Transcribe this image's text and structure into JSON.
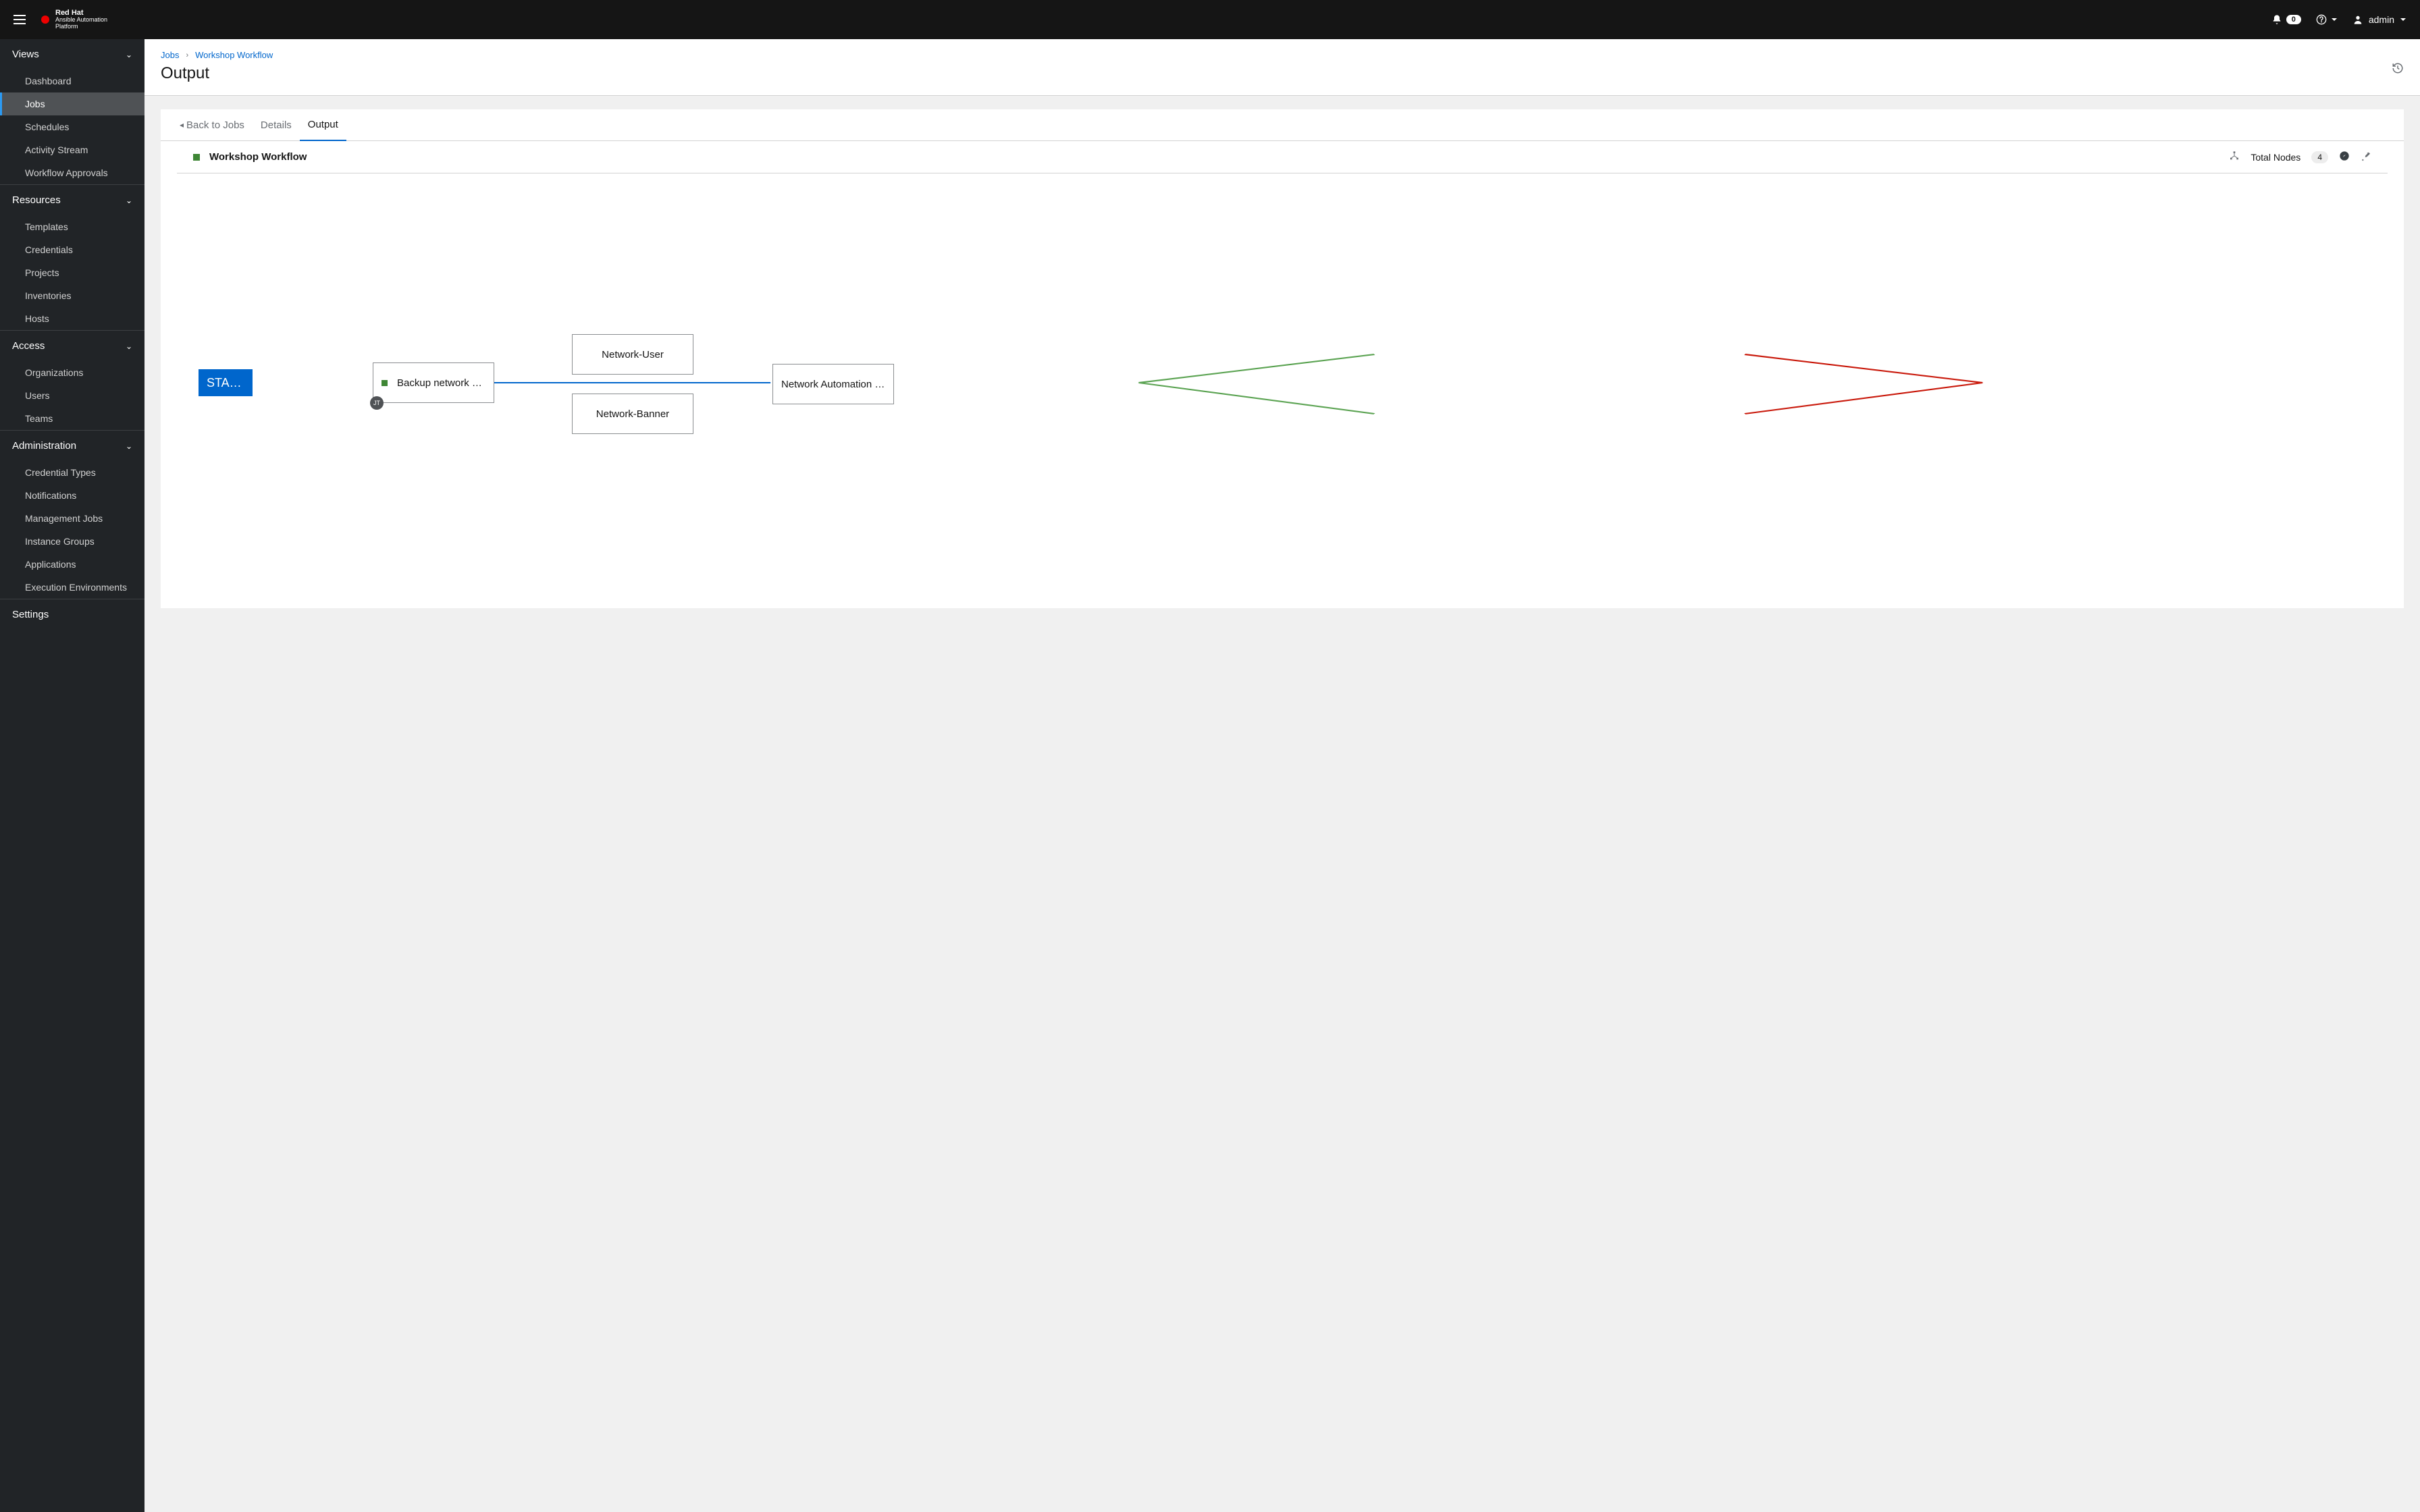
{
  "brand": {
    "line1": "Red Hat",
    "line2": "Ansible Automation",
    "line3": "Platform"
  },
  "header": {
    "notification_count": "0",
    "user": "admin"
  },
  "sidebar": {
    "groups": [
      {
        "label": "Views",
        "items": [
          "Dashboard",
          "Jobs",
          "Schedules",
          "Activity Stream",
          "Workflow Approvals"
        ],
        "active": "Jobs"
      },
      {
        "label": "Resources",
        "items": [
          "Templates",
          "Credentials",
          "Projects",
          "Inventories",
          "Hosts"
        ]
      },
      {
        "label": "Access",
        "items": [
          "Organizations",
          "Users",
          "Teams"
        ]
      },
      {
        "label": "Administration",
        "items": [
          "Credential Types",
          "Notifications",
          "Management Jobs",
          "Instance Groups",
          "Applications",
          "Execution Environments"
        ]
      },
      {
        "label": "Settings",
        "items": []
      }
    ]
  },
  "breadcrumb": {
    "jobs": "Jobs",
    "workflow": "Workshop Workflow"
  },
  "page": {
    "title": "Output"
  },
  "tabs": {
    "back": "Back to Jobs",
    "details": "Details",
    "output": "Output"
  },
  "workflow": {
    "title": "Workshop Workflow",
    "total_nodes_label": "Total Nodes",
    "total_nodes_count": "4",
    "jt_badge": "JT",
    "nodes": {
      "start": "START",
      "backup": "Backup network confi…",
      "user": "Network-User",
      "banner": "Network-Banner",
      "automation": "Network Automation - Re…"
    }
  }
}
